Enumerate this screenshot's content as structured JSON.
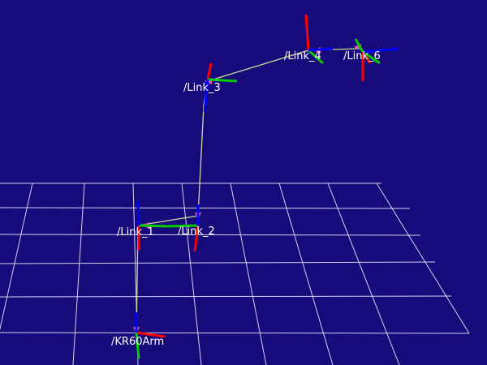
{
  "view": {
    "background_color": "#170a7a",
    "grid_color": "#e8e8ff",
    "link_line_color": "#d8d6a0",
    "arrow_color": "#e85aa8",
    "axis_colors": {
      "x": "#ff0000",
      "y": "#00cc00",
      "z": "#0000ff"
    }
  },
  "frames": [
    {
      "id": "base",
      "label": "/KR60Arm"
    },
    {
      "id": "link1",
      "label": "/Link_1"
    },
    {
      "id": "link2",
      "label": "/Link_2"
    },
    {
      "id": "link3",
      "label": "/Link_3"
    },
    {
      "id": "link4",
      "label": "/Link_4"
    },
    {
      "id": "link6",
      "label": "/Link_6"
    }
  ]
}
